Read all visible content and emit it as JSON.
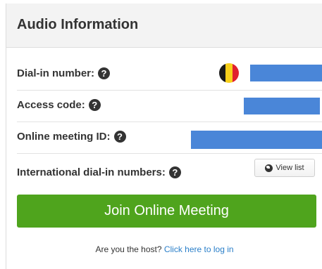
{
  "header": {
    "title": "Audio Information"
  },
  "rows": {
    "dial_in": {
      "label": "Dial-in number:",
      "help_icon": "question-circle-icon",
      "flag": "belgium-flag",
      "flag_colors": [
        "#1a1a1a",
        "#f7cf1b",
        "#e0202f"
      ],
      "value_redacted": true
    },
    "access_code": {
      "label": "Access code:",
      "help_icon": "question-circle-icon",
      "value_redacted": true
    },
    "meeting_id": {
      "label": "Online meeting ID:",
      "help_icon": "question-circle-icon",
      "value_redacted": true
    },
    "international": {
      "label": "International dial-in numbers:",
      "help_icon": "question-circle-icon",
      "button_label": "View list",
      "button_icon": "globe-icon"
    }
  },
  "join_button": {
    "label": "Join Online Meeting"
  },
  "footer": {
    "prompt": "Are you the host?",
    "link": "Click here to log in"
  },
  "colors": {
    "accent_green": "#4fa41d",
    "link_blue": "#2a7fc9",
    "redaction_blue": "#4a86d8"
  }
}
